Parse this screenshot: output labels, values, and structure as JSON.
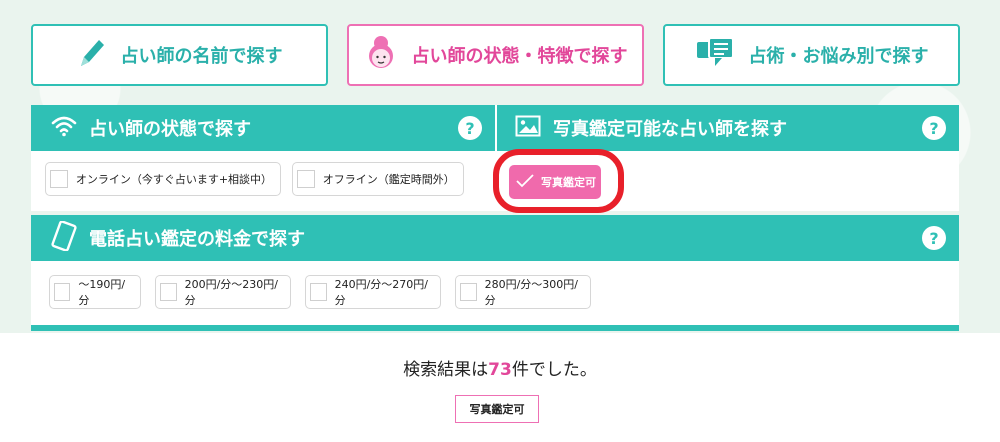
{
  "tabs": [
    {
      "label": "占い師の名前で探す",
      "icon": "pencil-icon"
    },
    {
      "label": "占い師の状態・特徴で探す",
      "icon": "fortune-teller-icon"
    },
    {
      "label": "占術・お悩み別で探す",
      "icon": "chat-bubbles-icon"
    }
  ],
  "status_section": {
    "title": "占い師の状態で探す",
    "help": "?",
    "options": [
      "オンライン（今すぐ占います+相談中）",
      "オフライン（鑑定時間外）"
    ]
  },
  "photo_section": {
    "title": "写真鑑定可能な占い師を探す",
    "help": "?",
    "option": "写真鑑定可"
  },
  "price_section": {
    "title": "電話占い鑑定の料金で探す",
    "help": "?",
    "options": [
      "〜190円/分",
      "200円/分〜230円/分",
      "240円/分〜270円/分",
      "280円/分〜300円/分"
    ]
  },
  "result": {
    "prefix": "検索結果は",
    "count": "73",
    "suffix": "件でした。",
    "active_filter": "写真鑑定可"
  },
  "colors": {
    "teal": "#2fc0b5",
    "pink": "#f06aac",
    "highlight": "#e8202a"
  }
}
